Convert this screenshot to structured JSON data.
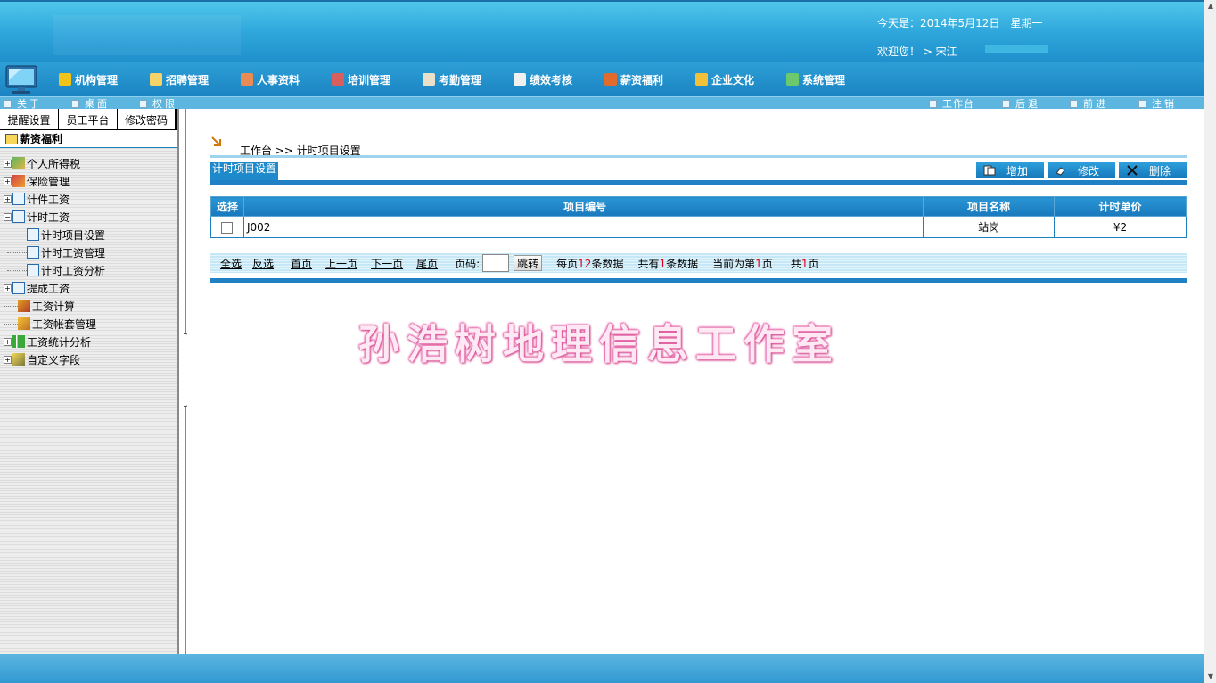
{
  "header": {
    "date_text": "今天是：2014年5月12日　星期一",
    "welcome_text": "欢迎您！ > 宋江"
  },
  "main_nav": [
    {
      "label": "机构管理",
      "icon": "org-icon",
      "color": "#f2c318"
    },
    {
      "label": "招聘管理",
      "icon": "recruit-icon",
      "color": "#f5d26a"
    },
    {
      "label": "人事资料",
      "icon": "personnel-icon",
      "color": "#e98b54"
    },
    {
      "label": "培训管理",
      "icon": "training-icon",
      "color": "#d95f5f"
    },
    {
      "label": "考勤管理",
      "icon": "attendance-icon",
      "color": "#e8e0c8"
    },
    {
      "label": "绩效考核",
      "icon": "performance-icon",
      "color": "#f0f0f0"
    },
    {
      "label": "薪资福利",
      "icon": "salary-icon",
      "color": "#e06b2d"
    },
    {
      "label": "企业文化",
      "icon": "culture-icon",
      "color": "#f3c03a"
    },
    {
      "label": "系统管理",
      "icon": "system-icon",
      "color": "#6cc86c"
    }
  ],
  "sub_nav": {
    "left": [
      "关于",
      "桌面",
      "权限"
    ],
    "right": [
      "工作台",
      "后退",
      "前进",
      "注销"
    ]
  },
  "sidebar": {
    "tabs": [
      "提醒设置",
      "员工平台",
      "修改密码"
    ],
    "section": "薪资福利",
    "tree": [
      {
        "label": "个人所得税",
        "expand": "+",
        "icon": "tax-icon",
        "level": 0
      },
      {
        "label": "保险管理",
        "expand": "+",
        "icon": "insurance-icon",
        "level": 0
      },
      {
        "label": "计件工资",
        "expand": "+",
        "icon": "doc-icon",
        "level": 0
      },
      {
        "label": "计时工资",
        "expand": "-",
        "icon": "doc-icon",
        "level": 0
      },
      {
        "label": "计时项目设置",
        "expand": "",
        "icon": "doc-icon",
        "level": 1
      },
      {
        "label": "计时工资管理",
        "expand": "",
        "icon": "doc-icon",
        "level": 1
      },
      {
        "label": "计时工资分析",
        "expand": "",
        "icon": "doc-icon",
        "level": 1
      },
      {
        "label": "提成工资",
        "expand": "+",
        "icon": "doc-icon",
        "level": 0
      },
      {
        "label": "工资计算",
        "expand": "",
        "icon": "calc-icon",
        "level": 0
      },
      {
        "label": "工资帐套管理",
        "expand": "",
        "icon": "ledger-icon",
        "level": 0
      },
      {
        "label": "工资统计分析",
        "expand": "+",
        "icon": "chart-icon",
        "level": 0
      },
      {
        "label": "自定义字段",
        "expand": "+",
        "icon": "custom-field-icon",
        "level": 0
      }
    ]
  },
  "breadcrumb": "工作台 >> 计时项目设置",
  "toolbar": {
    "tab_label": "计时项目设置",
    "add_label": "增加",
    "edit_label": "修改",
    "delete_label": "删除"
  },
  "grid": {
    "headers": [
      "选择",
      "项目编号",
      "项目名称",
      "计时单价"
    ],
    "rows": [
      {
        "code": "J002",
        "name": "站岗",
        "price": "¥2"
      }
    ]
  },
  "pager": {
    "select_all": "全选",
    "invert": "反选",
    "first": "首页",
    "prev": "上一页",
    "next": "下一页",
    "last": "尾页",
    "page_label": "页码:",
    "go": "跳转",
    "per_page_prefix": "每页",
    "per_page": "12",
    "per_page_suffix": "条数据",
    "total_prefix": "共有",
    "total": "1",
    "total_suffix": "条数据",
    "current_prefix": "当前为第",
    "current": "1",
    "current_suffix": "页",
    "pages_prefix": "共",
    "pages": "1",
    "pages_suffix": "页"
  },
  "watermark": "孙浩树地理信息工作室",
  "colors": {
    "accent_blue": "#1f80c4",
    "highlight_red": "#e0001a"
  }
}
